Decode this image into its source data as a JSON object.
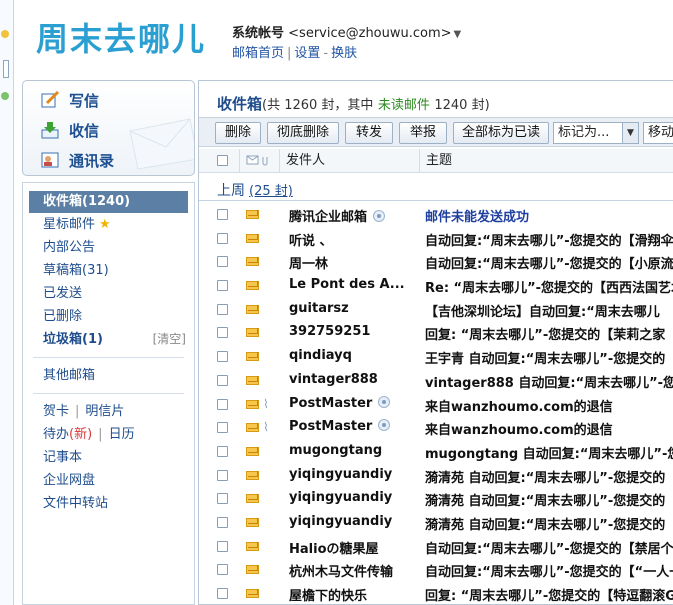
{
  "header": {
    "logo": "周末去哪儿",
    "account_label": "系统帐号",
    "account_email": "<service@zhouwu.com>",
    "links": [
      "邮箱首页",
      "设置",
      "换肤"
    ]
  },
  "actions": [
    {
      "label": "写信",
      "icon": "write-icon"
    },
    {
      "label": "收信",
      "icon": "receive-icon"
    },
    {
      "label": "通讯录",
      "icon": "contacts-icon"
    }
  ],
  "folders": {
    "inbox": "收件箱(1240)",
    "starred": "星标邮件",
    "announcements": "内部公告",
    "drafts": "草稿箱(31)",
    "sent": "已发送",
    "deleted": "已删除",
    "spam": "垃圾箱(1)",
    "spam_clear": "[清空]",
    "other": "其他邮箱",
    "greeting_card": "贺卡",
    "postcard": "明信片",
    "todo": "待办",
    "todo_new": "(新)",
    "calendar": "日历",
    "notes": "记事本",
    "netdisk": "企业网盘",
    "file_transfer": "文件中转站"
  },
  "main": {
    "title": "收件箱",
    "count_prefix": "(共 1260 封，其中",
    "unread_label": "未读邮件",
    "count_suffix": "1240 封)",
    "toolbar": {
      "delete": "删除",
      "perm_delete": "彻底删除",
      "forward": "转发",
      "report": "举报",
      "mark_all_read": "全部标为已读",
      "mark_as": "标记为...",
      "move_to": "移动到"
    },
    "columns": {
      "sender": "发件人",
      "subject": "主题"
    },
    "week_label": "上周",
    "week_count": "(25 封)"
  },
  "emails": [
    {
      "from": "腾讯企业邮箱",
      "subject": "邮件未能发送成功",
      "clip": false,
      "qq": true,
      "blue": true
    },
    {
      "from": "听说 、",
      "subject": "自动回复:“周末去哪儿”-您提交的【滑翔伞火",
      "clip": false,
      "qq": false,
      "blue": false
    },
    {
      "from": "周一林",
      "subject": "自动回复:“周末去哪儿”-您提交的【小原流插",
      "clip": false,
      "qq": false,
      "blue": false
    },
    {
      "from": "Le Pont des A...",
      "subject": "Re: “周末去哪儿”-您提交的【西西法国艺术",
      "clip": false,
      "qq": false,
      "blue": false
    },
    {
      "from": "guitarsz",
      "subject": "【吉他深圳论坛】自动回复:“周末去哪儿",
      "clip": false,
      "qq": false,
      "blue": false
    },
    {
      "from": "392759251",
      "subject": "回复: “周末去哪儿”-您提交的【茉莉之家",
      "clip": false,
      "qq": false,
      "blue": false
    },
    {
      "from": "qindiayq",
      "subject": "王宇青 自动回复:“周末去哪儿”-您提交的【",
      "clip": false,
      "qq": false,
      "blue": false
    },
    {
      "from": "vintager888",
      "subject": "vintager888 自动回复:“周末去哪儿”-您提",
      "clip": false,
      "qq": false,
      "blue": false
    },
    {
      "from": "PostMaster",
      "subject": "来自wanzhoumo.com的退信",
      "clip": true,
      "qq": true,
      "blue": false
    },
    {
      "from": "PostMaster",
      "subject": "来自wanzhoumo.com的退信",
      "clip": true,
      "qq": true,
      "blue": false
    },
    {
      "from": "mugongtang",
      "subject": "mugongtang 自动回复:“周末去哪儿”-您提",
      "clip": false,
      "qq": false,
      "blue": false
    },
    {
      "from": "yiqingyuandiy",
      "subject": "漪清苑 自动回复:“周末去哪儿”-您提交的【",
      "clip": false,
      "qq": false,
      "blue": false
    },
    {
      "from": "yiqingyuandiy",
      "subject": "漪清苑 自动回复:“周末去哪儿”-您提交的【",
      "clip": false,
      "qq": false,
      "blue": false
    },
    {
      "from": "yiqingyuandiy",
      "subject": "漪清苑 自动回复:“周末去哪儿”-您提交的【",
      "clip": false,
      "qq": false,
      "blue": false
    },
    {
      "from": "Halioの糖果屋",
      "subject": "自动回复:“周末去哪儿”-您提交的【禁居个原",
      "clip": false,
      "qq": false,
      "blue": false
    },
    {
      "from": "杭州木马文件传输",
      "subject": "自动回复:“周末去哪儿”-您提交的【“一人一",
      "clip": false,
      "qq": false,
      "blue": false
    },
    {
      "from": "屋檐下的快乐",
      "subject": "回复: “周末去哪儿”-您提交的【特逗翻滚G",
      "clip": false,
      "qq": false,
      "blue": false
    }
  ],
  "colors": {
    "logo": "#2a9fd2",
    "link": "#2255a4",
    "active_folder": "#5b7fa5",
    "unread": "#2e8b22"
  }
}
